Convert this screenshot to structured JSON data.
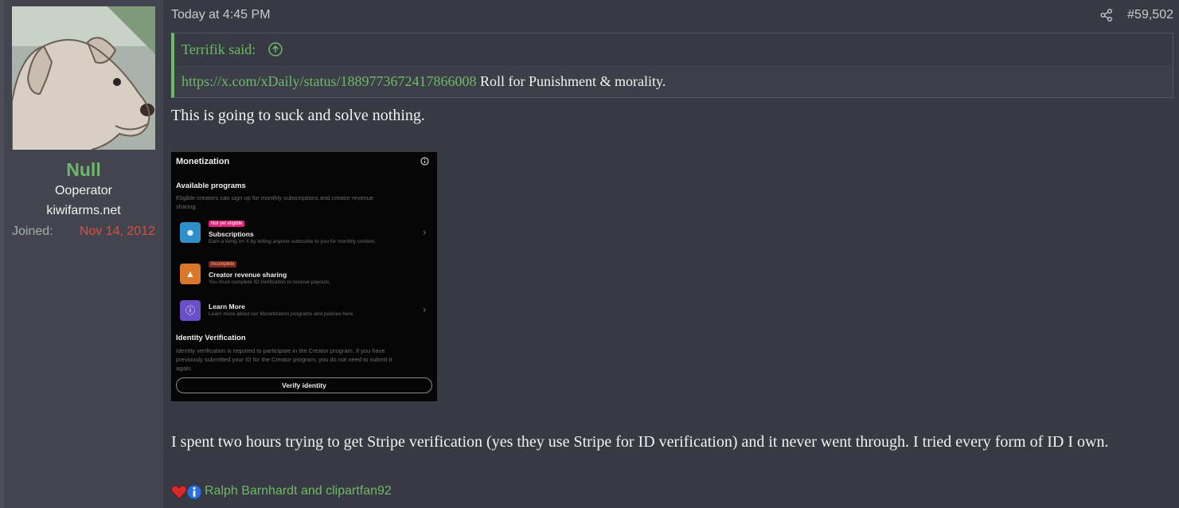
{
  "user": {
    "name": "Null",
    "title": "Ooperator",
    "site": "kiwifarms.net",
    "joined_label": "Joined:",
    "joined_date": "Nov 14, 2012"
  },
  "post": {
    "date": "Today at 4:45 PM",
    "number": "#59,502",
    "quote": {
      "author": "Terrifik said:",
      "link": "https://x.com/xDaily/status/1889773672417866008",
      "text": " Roll for Punishment & morality."
    },
    "line1": "This is going to suck and solve nothing.",
    "line2": "I spent two hours trying to get Stripe verification (yes they use Stripe for ID verification) and it never went through. I tried every form of ID I own."
  },
  "attachment": {
    "header": "Monetization",
    "available_title": "Available programs",
    "available_sub1": "Eligible creators can sign up for monthly subscriptions and creator revenue",
    "available_sub2": "sharing.",
    "sub_badge": "Not yet eligible",
    "sub_title": "Subscriptions",
    "sub_desc": "Earn a living on X by letting anyone subscribe to you for monthly content.",
    "rev_badge": "Incomplete",
    "rev_title": "Creator revenue sharing",
    "rev_desc": "You must complete ID Verification to receive payouts.",
    "learn_title": "Learn More",
    "learn_desc": "Learn more about our Monetization programs and policies here.",
    "id_title": "Identity Verification",
    "id_desc1": "Identity verification is required to participate in the Creator program. If you have",
    "id_desc2": "previously submitted your ID for the Creator program, you do not need to submit it",
    "id_desc3": "again.",
    "verify_button": "Verify identity"
  },
  "reactions": {
    "icons": [
      "heart-icon",
      "info-icon"
    ],
    "names": "Ralph Barnhardt and clipartfan92"
  },
  "colors": {
    "accent_green": "#6fb86a",
    "date_red": "#e24a44",
    "background": "#373a42"
  }
}
